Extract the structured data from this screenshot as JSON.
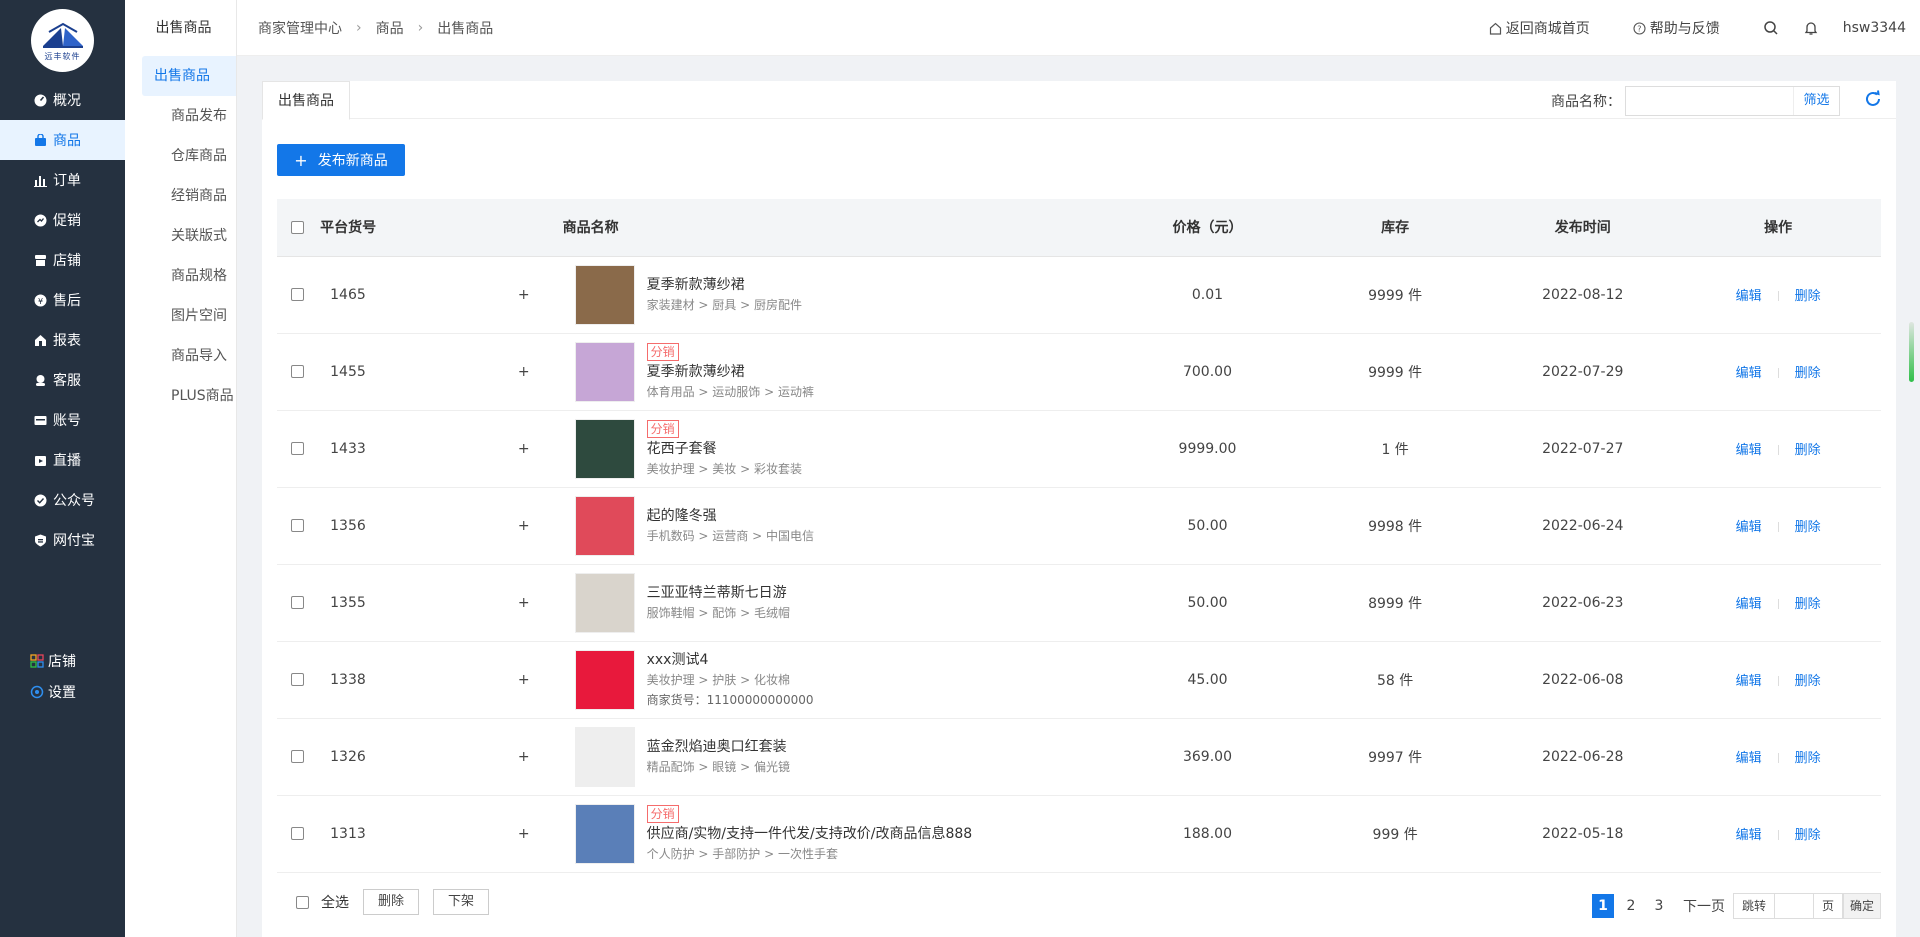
{
  "logo": {
    "text": "远丰软件"
  },
  "sidebar": {
    "items": [
      {
        "label": "概况",
        "icon": "dashboard-icon"
      },
      {
        "label": "商品",
        "icon": "bag-icon",
        "active": true
      },
      {
        "label": "订单",
        "icon": "bar-chart-icon"
      },
      {
        "label": "促销",
        "icon": "promo-icon"
      },
      {
        "label": "店铺",
        "icon": "store-icon"
      },
      {
        "label": "售后",
        "icon": "aftersale-icon"
      },
      {
        "label": "报表",
        "icon": "report-icon"
      },
      {
        "label": "客服",
        "icon": "service-icon"
      },
      {
        "label": "账号",
        "icon": "account-icon"
      },
      {
        "label": "直播",
        "icon": "live-icon"
      },
      {
        "label": "公众号",
        "icon": "wechat-icon"
      },
      {
        "label": "网付宝",
        "icon": "shield-icon"
      }
    ],
    "bottom": [
      {
        "label": "店铺",
        "icon": "grid-icon"
      },
      {
        "label": "设置",
        "icon": "settings-icon"
      }
    ]
  },
  "subnav": {
    "title": "出售商品",
    "items": [
      "出售商品",
      "商品发布",
      "仓库商品",
      "经销商品",
      "关联版式",
      "商品规格",
      "图片空间",
      "商品导入",
      "PLUS商品"
    ]
  },
  "breadcrumb": [
    "商家管理中心",
    "商品",
    "出售商品"
  ],
  "header": {
    "back_home": "返回商城首页",
    "help": "帮助与反馈",
    "username": "hsw3344"
  },
  "tab": {
    "label": "出售商品"
  },
  "filter": {
    "label": "商品名称：",
    "placeholder": "",
    "button": "筛选"
  },
  "publish_button": "发布新商品",
  "table": {
    "headers": [
      "平台货号",
      "商品名称",
      "价格（元）",
      "库存",
      "发布时间",
      "操作"
    ],
    "edit_label": "编辑",
    "delete_label": "删除",
    "rows": [
      {
        "id": "1465",
        "tag": "",
        "name": "夏季新款薄纱裙",
        "category": "家装建材 > 厨具 > 厨房配件",
        "extra": "",
        "price": "0.01",
        "stock": "9999 件",
        "date": "2022-08-12",
        "thumb_color": "#8a6a4a"
      },
      {
        "id": "1455",
        "tag": "分销",
        "name": "夏季新款薄纱裙",
        "category": "体育用品 > 运动服饰 > 运动裤",
        "extra": "",
        "price": "700.00",
        "stock": "9999 件",
        "date": "2022-07-29",
        "thumb_color": "#c6a6d6"
      },
      {
        "id": "1433",
        "tag": "分销",
        "name": "花西子套餐",
        "category": "美妆护理 > 美妆 > 彩妆套装",
        "extra": "",
        "price": "9999.00",
        "stock": "1 件",
        "date": "2022-07-27",
        "thumb_color": "#2e4a3e"
      },
      {
        "id": "1356",
        "tag": "",
        "name": "起的隆冬强",
        "category": "手机数码 > 运营商 > 中国电信",
        "extra": "",
        "price": "50.00",
        "stock": "9998 件",
        "date": "2022-06-24",
        "thumb_color": "#e04a5a"
      },
      {
        "id": "1355",
        "tag": "",
        "name": "三亚亚特兰蒂斯七日游",
        "category": "服饰鞋帽 > 配饰 > 毛绒帽",
        "extra": "",
        "price": "50.00",
        "stock": "8999 件",
        "date": "2022-06-23",
        "thumb_color": "#d9d4cc"
      },
      {
        "id": "1338",
        "tag": "",
        "name": "xxx测试4",
        "category": "美妆护理 > 护肤 > 化妆棉",
        "extra": "商家货号：11100000000000",
        "price": "45.00",
        "stock": "58 件",
        "date": "2022-06-08",
        "thumb_color": "#e8193c"
      },
      {
        "id": "1326",
        "tag": "",
        "name": "蓝金烈焰迪奥口红套装",
        "category": "精品配饰 > 眼镜 > 偏光镜",
        "extra": "",
        "price": "369.00",
        "stock": "9997 件",
        "date": "2022-06-28",
        "thumb_color": "#eeeeee"
      },
      {
        "id": "1313",
        "tag": "分销",
        "name": "供应商/实物/支持一件代发/支持改价/改商品信息888",
        "category": "个人防护 > 手部防护 > 一次性手套",
        "extra": "",
        "price": "188.00",
        "stock": "999 件",
        "date": "2022-05-18",
        "thumb_color": "#5a7fb8"
      }
    ]
  },
  "footer": {
    "select_all": "全选",
    "delete": "删除",
    "offshelf": "下架"
  },
  "pager": {
    "pages": [
      "1",
      "2",
      "3"
    ],
    "current": "1",
    "next": "下一页",
    "jump": "跳转",
    "page_unit": "页",
    "confirm": "确定"
  }
}
